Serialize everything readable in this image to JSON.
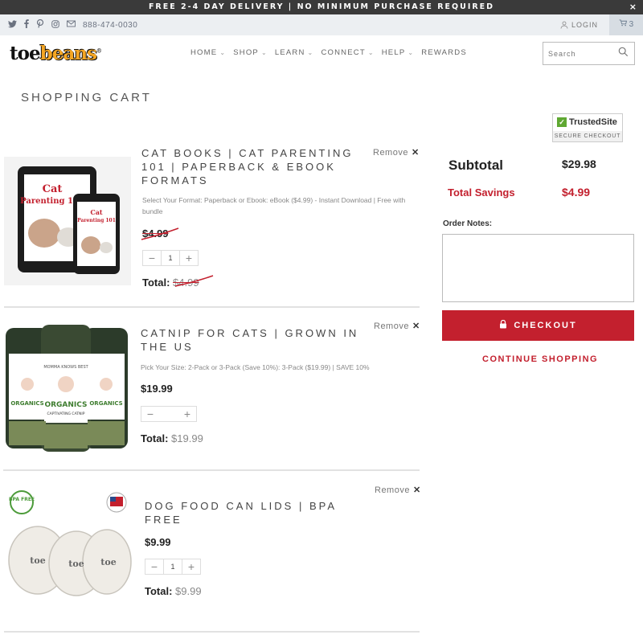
{
  "announcement": {
    "text": "FREE 2-4 DAY DELIVERY | NO MINIMUM PURCHASE REQUIRED",
    "close": "×"
  },
  "utility": {
    "phone": "888-474-0030",
    "login": "LOGIN",
    "cart_count": "3"
  },
  "logo": {
    "toe": "toe",
    "beans": "beans",
    "mark": "®"
  },
  "nav": {
    "items": [
      "HOME",
      "SHOP",
      "LEARN",
      "CONNECT",
      "HELP",
      "REWARDS"
    ]
  },
  "search": {
    "placeholder": "Search"
  },
  "page": {
    "title": "SHOPPING CART"
  },
  "cart": {
    "remove_label": "Remove",
    "total_label": "Total:",
    "items": [
      {
        "title": "CAT BOOKS | CAT PARENTING 101 | PAPERBACK & EBOOK FORMATS",
        "variant": "Select Your Format: Paperback or Ebook: eBook ($4.99) - Instant Download | Free with bundle",
        "price": "$4.99",
        "quantity": "1",
        "total": "$4.99"
      },
      {
        "title": "CATNIP FOR CATS | GROWN IN THE US",
        "variant": "Pick Your Size: 2-Pack or 3-Pack (Save 10%): 3-Pack ($19.99) | SAVE 10%",
        "price": "$19.99",
        "total": "$19.99"
      },
      {
        "title": "DOG FOOD CAN LIDS | BPA FREE",
        "price": "$9.99",
        "quantity": "1",
        "total": "$9.99"
      }
    ]
  },
  "images": {
    "book_title_line1": "Cat",
    "book_title_line2": "Parenting 101",
    "catnip_brand": "ORGANICS",
    "catnip_top": "MOMMA KNOWS BEST",
    "catnip_sub": "CAPTIVATING CATNIP",
    "bpa_badge": "BPA FREE"
  },
  "trust": {
    "name": "TrustedSite",
    "sub": "SECURE CHECKOUT"
  },
  "summary": {
    "subtotal_label": "Subtotal",
    "subtotal_value": "$29.98",
    "savings_label": "Total Savings",
    "savings_value": "$4.99",
    "notes_label": "Order Notes:",
    "checkout_label": "CHECKOUT",
    "continue_label": "CONTINUE SHOPPING"
  },
  "colors": {
    "accent": "#c3202e",
    "announce_bg": "#3a3a3a",
    "util_bg": "#eceff2"
  }
}
